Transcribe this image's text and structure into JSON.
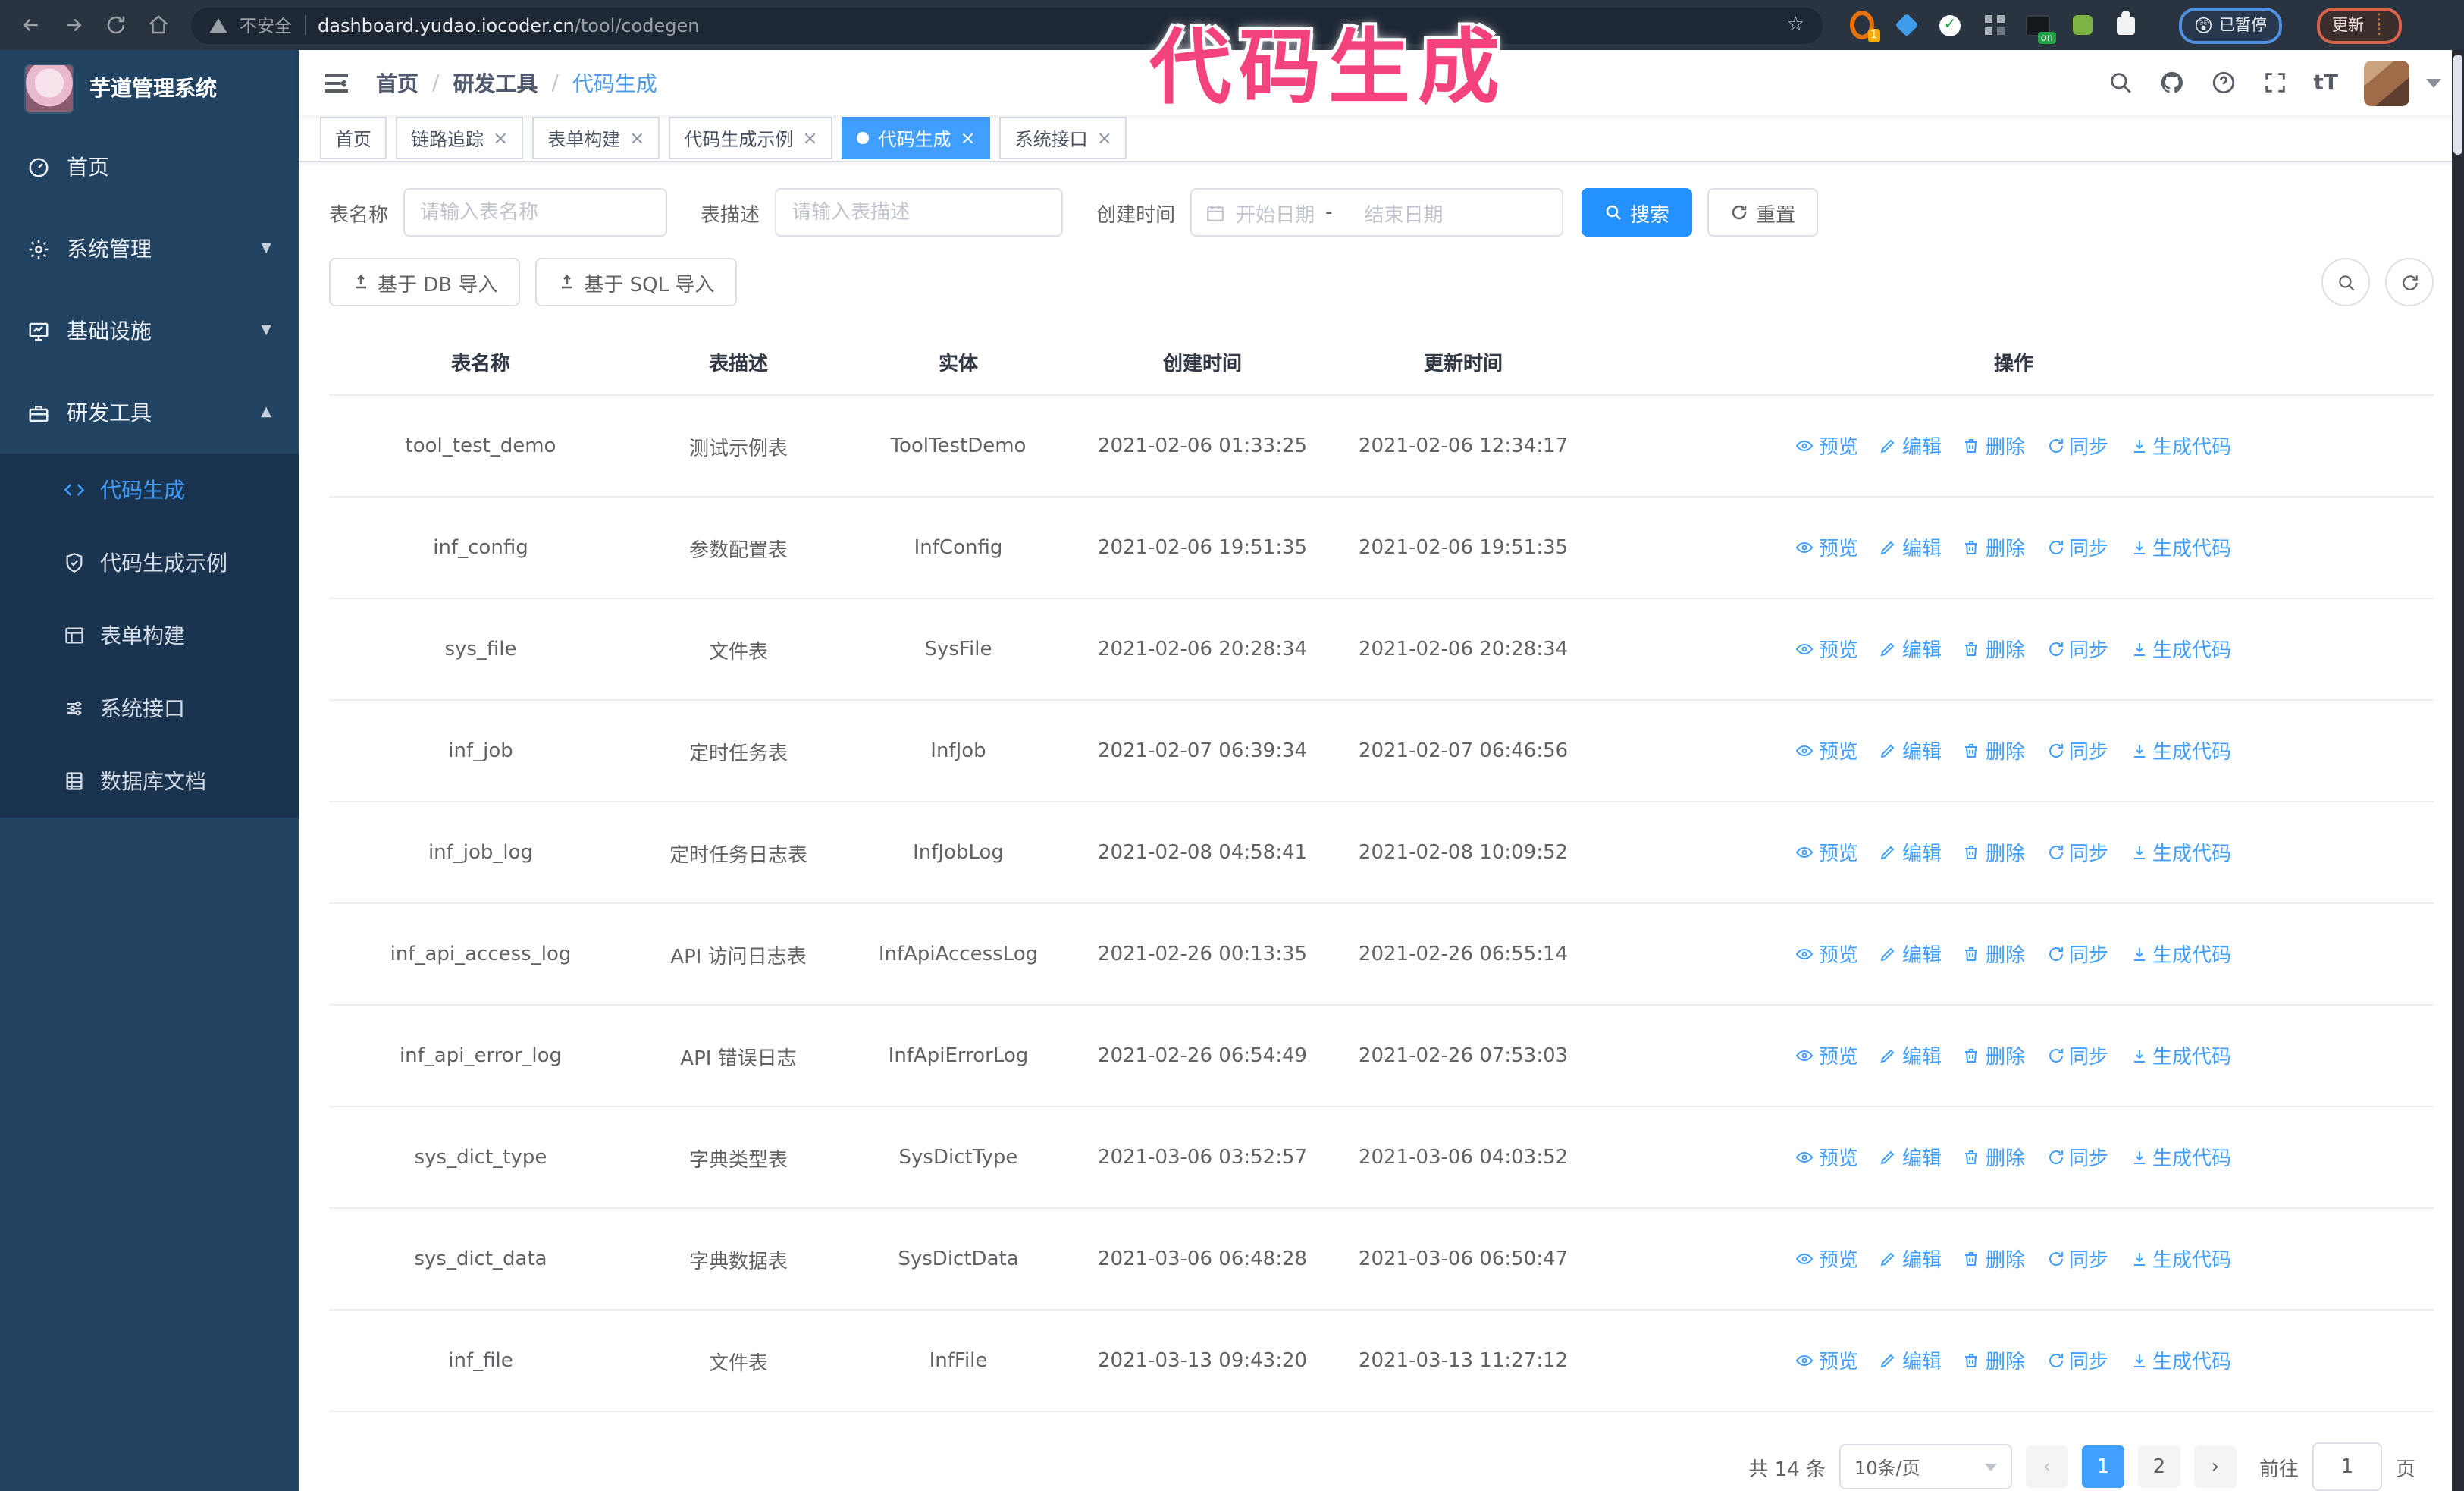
{
  "browser": {
    "security_label": "不安全",
    "url_domain": "dashboard.yudao.iocoder.cn",
    "url_path": "/tool/codegen",
    "ext1_badge": "1",
    "ext_on_badge": "on",
    "paused_badge": "已暂停",
    "paused_face": "😲",
    "update_button": "更新"
  },
  "annotation": {
    "text": "代码生成",
    "color": "#f4437c"
  },
  "sidebar": {
    "title": "芋道管理系统",
    "items": [
      {
        "label": "首页"
      },
      {
        "label": "系统管理"
      },
      {
        "label": "基础设施"
      },
      {
        "label": "研发工具"
      }
    ],
    "subitems": [
      {
        "label": "代码生成"
      },
      {
        "label": "代码生成示例"
      },
      {
        "label": "表单构建"
      },
      {
        "label": "系统接口"
      },
      {
        "label": "数据库文档"
      }
    ]
  },
  "breadcrumb": {
    "items": [
      "首页",
      "研发工具",
      "代码生成"
    ]
  },
  "tabs": [
    {
      "label": "首页"
    },
    {
      "label": "链路追踪"
    },
    {
      "label": "表单构建"
    },
    {
      "label": "代码生成示例"
    },
    {
      "label": "代码生成"
    },
    {
      "label": "系统接口"
    }
  ],
  "filters": {
    "name_label": "表名称",
    "name_placeholder": "请输入表名称",
    "desc_label": "表描述",
    "desc_placeholder": "请输入表描述",
    "time_label": "创建时间",
    "start_placeholder": "开始日期",
    "range_separator": "-",
    "end_placeholder": "结束日期",
    "search_label": "搜索",
    "reset_label": "重置"
  },
  "toolbar": {
    "db_import_label": "基于 DB 导入",
    "sql_import_label": "基于 SQL 导入"
  },
  "table": {
    "columns": [
      "表名称",
      "表描述",
      "实体",
      "创建时间",
      "更新时间",
      "操作"
    ],
    "actions": [
      "预览",
      "编辑",
      "删除",
      "同步",
      "生成代码"
    ],
    "rows": [
      {
        "name": "tool_test_demo",
        "desc": "测试示例表",
        "entity": "ToolTestDemo",
        "created": "2021-02-06 01:33:25",
        "updated": "2021-02-06 12:34:17"
      },
      {
        "name": "inf_config",
        "desc": "参数配置表",
        "entity": "InfConfig",
        "created": "2021-02-06 19:51:35",
        "updated": "2021-02-06 19:51:35"
      },
      {
        "name": "sys_file",
        "desc": "文件表",
        "entity": "SysFile",
        "created": "2021-02-06 20:28:34",
        "updated": "2021-02-06 20:28:34"
      },
      {
        "name": "inf_job",
        "desc": "定时任务表",
        "entity": "InfJob",
        "created": "2021-02-07 06:39:34",
        "updated": "2021-02-07 06:46:56"
      },
      {
        "name": "inf_job_log",
        "desc": "定时任务日志表",
        "entity": "InfJobLog",
        "created": "2021-02-08 04:58:41",
        "updated": "2021-02-08 10:09:52"
      },
      {
        "name": "inf_api_access_log",
        "desc": "API 访问日志表",
        "entity": "InfApiAccessLog",
        "created": "2021-02-26 00:13:35",
        "updated": "2021-02-26 06:55:14"
      },
      {
        "name": "inf_api_error_log",
        "desc": "API 错误日志",
        "entity": "InfApiErrorLog",
        "created": "2021-02-26 06:54:49",
        "updated": "2021-02-26 07:53:03"
      },
      {
        "name": "sys_dict_type",
        "desc": "字典类型表",
        "entity": "SysDictType",
        "created": "2021-03-06 03:52:57",
        "updated": "2021-03-06 04:03:52"
      },
      {
        "name": "sys_dict_data",
        "desc": "字典数据表",
        "entity": "SysDictData",
        "created": "2021-03-06 06:48:28",
        "updated": "2021-03-06 06:50:47"
      },
      {
        "name": "inf_file",
        "desc": "文件表",
        "entity": "InfFile",
        "created": "2021-03-13 09:43:20",
        "updated": "2021-03-13 11:27:12"
      }
    ]
  },
  "pagination": {
    "total": "共 14 条",
    "page_size": "10条/页",
    "pages": [
      "1",
      "2"
    ],
    "current": "1",
    "goto_label": "前往",
    "goto_value": "1",
    "page_suffix": "页"
  },
  "colors": {
    "primary": "#409eff",
    "sidebar": "#224261",
    "annotation": "#f4437c"
  }
}
